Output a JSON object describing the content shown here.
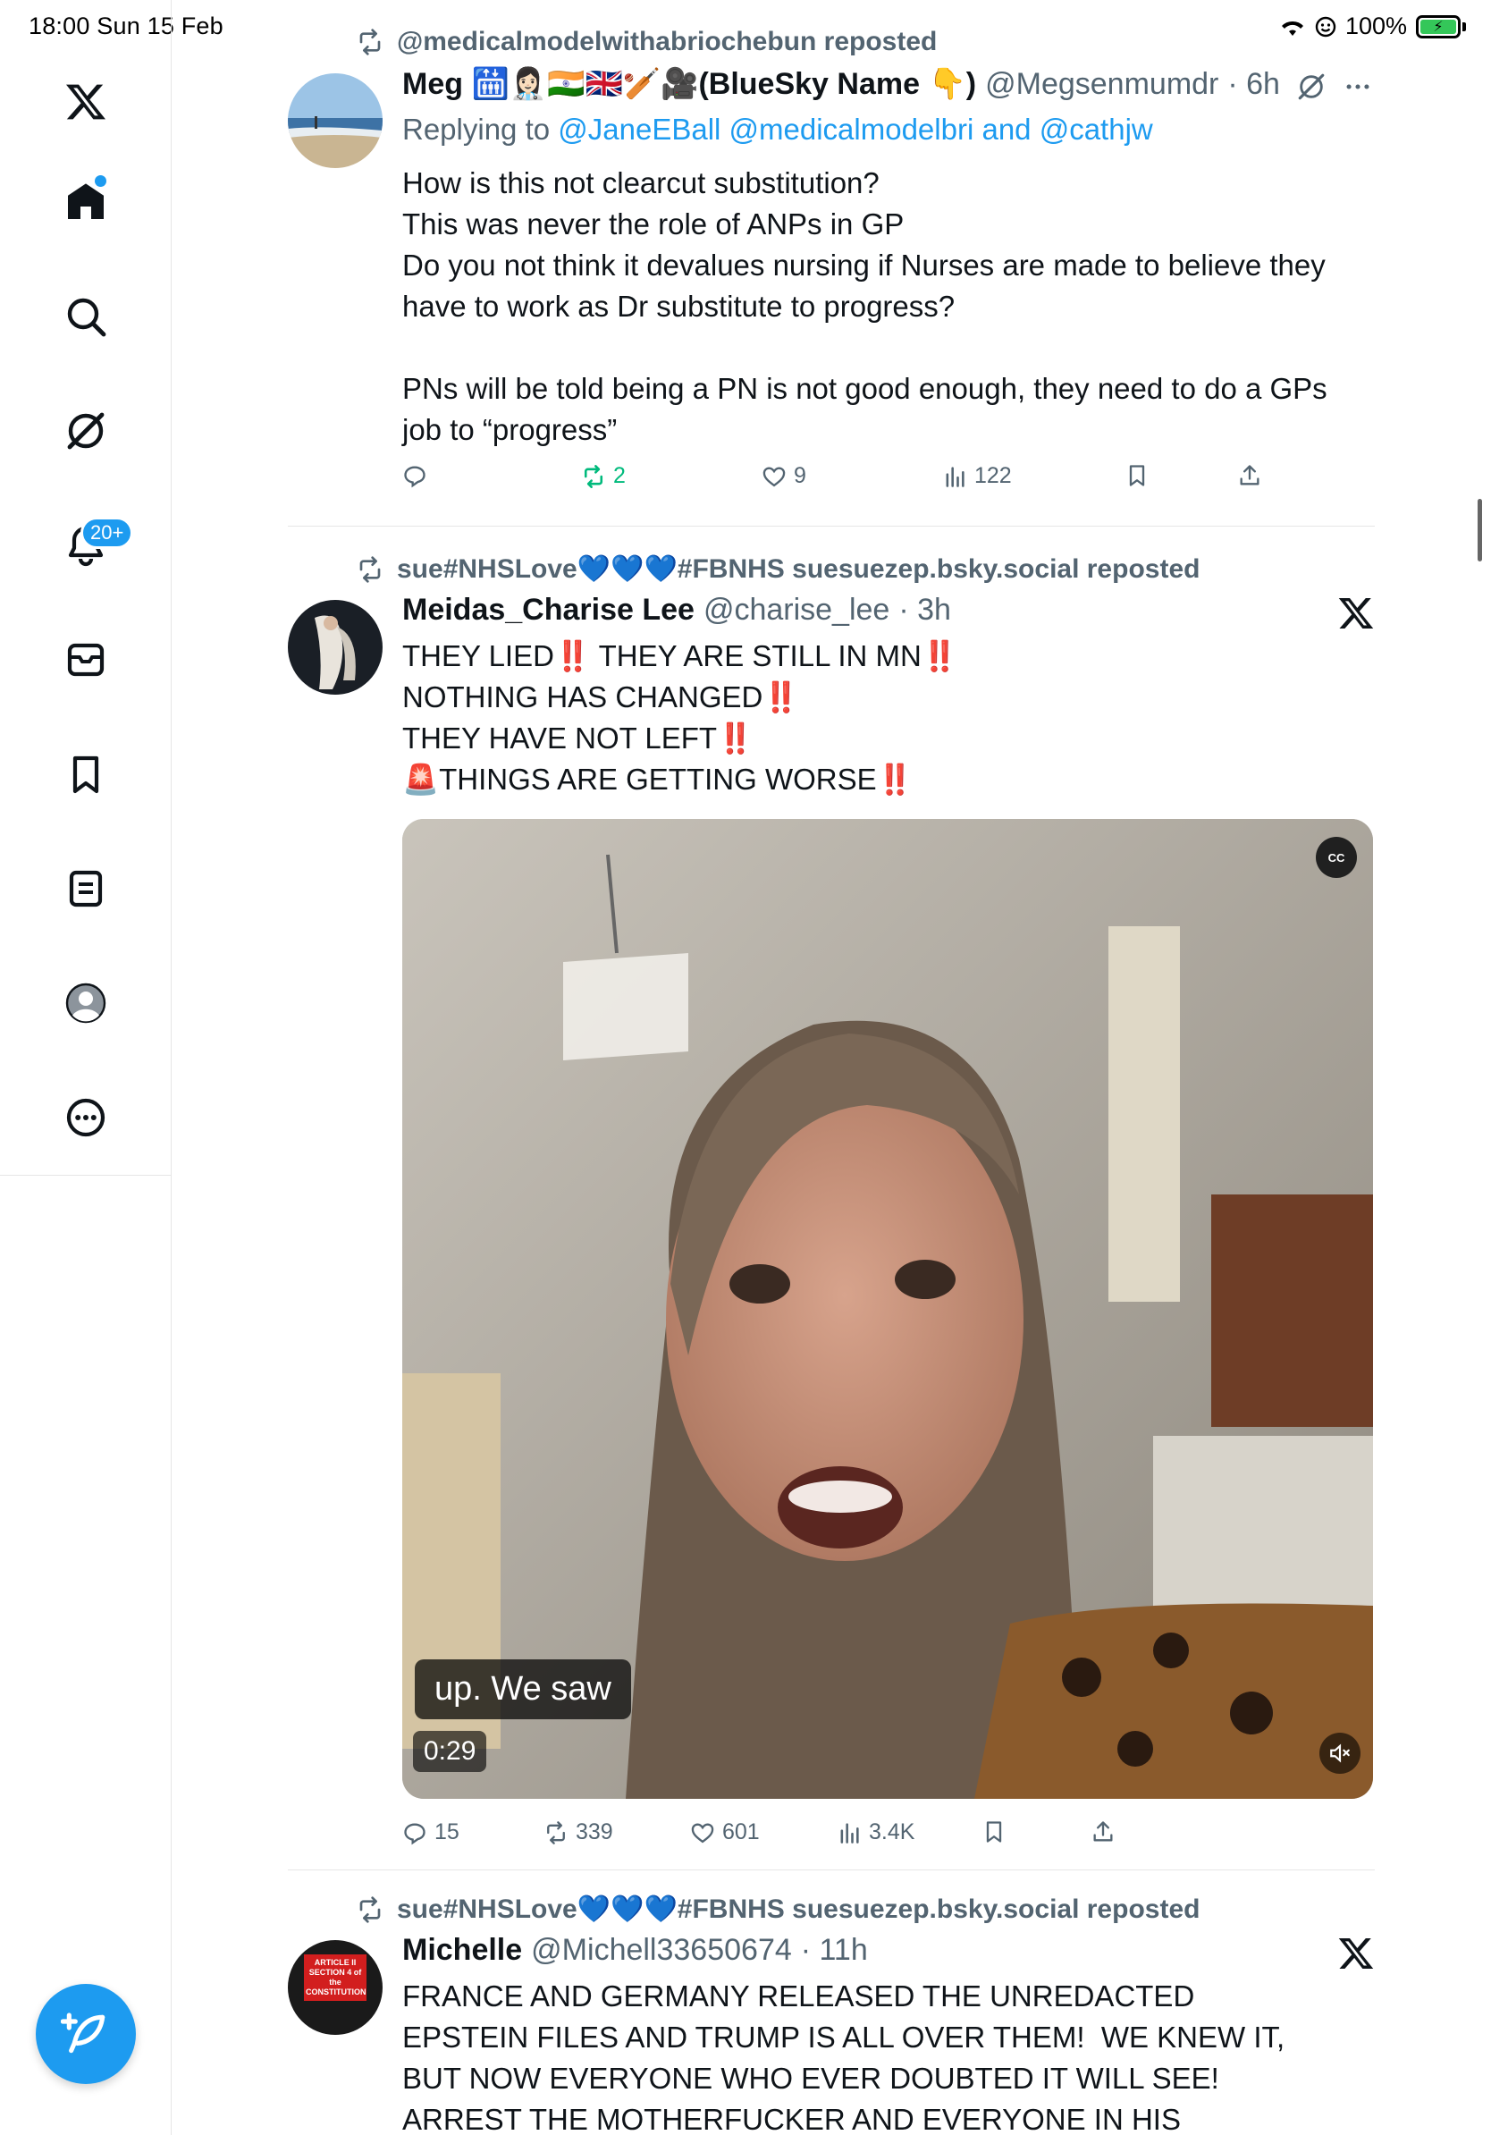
{
  "status_bar": {
    "time_date": "18:00  Sun 15 Feb",
    "battery": "100%"
  },
  "sidebar": {
    "notifications_badge": "20+"
  },
  "tweets": [
    {
      "repost_label": "@medicalmodelwithabriochebun reposted",
      "name": "Meg 🛗👩🏻‍⚕️🇮🇳🇬🇧🏏🎥(BlueSky Name 👇)",
      "handle": "@Megsenmumdr",
      "time": "· 6h",
      "reply_prefix": "Replying to ",
      "reply_targets": "@JaneEBall @medicalmodelbri and @cathjw",
      "body": [
        "How is this not clearcut substitution?",
        "This was never the role of ANPs in GP",
        "Do you not think it devalues nursing if Nurses are made to believe they have to work as Dr substitute to progress?",
        "",
        "PNs will be told being a PN is not good enough, they need to do a GPs job to “progress”"
      ],
      "stats": {
        "replies": "",
        "reposts": "2",
        "likes": "9",
        "views": "122"
      }
    },
    {
      "repost_label": "sue#NHSLove💙💙💙#FBNHS suesuezep.bsky.social reposted",
      "name": "Meidas_Charise Lee",
      "handle": "@charise_lee",
      "time": "· 3h",
      "body": [
        "THEY LIED‼️ THEY ARE STILL IN MN‼️",
        "NOTHING HAS CHANGED‼️",
        "THEY HAVE NOT LEFT‼️",
        "🚨THINGS ARE GETTING WORSE‼️"
      ],
      "video": {
        "caption": "up. We saw",
        "duration": "0:29",
        "cc_label": "CC"
      },
      "stats": {
        "replies": "15",
        "reposts": "339",
        "likes": "601",
        "views": "3.4K"
      }
    },
    {
      "repost_label": "sue#NHSLove💙💙💙#FBNHS suesuezep.bsky.social reposted",
      "name": "Michelle",
      "handle": "@Michell33650674",
      "time": "· 11h",
      "avatar_text": "ARTICLE II SECTION 4 of the CONSTITUTION",
      "body": [
        "FRANCE AND GERMANY RELEASED THE UNREDACTED EPSTEIN FILES AND TRUMP IS ALL OVER THEM!  WE KNEW IT, BUT NOW EVERYONE WHO EVER DOUBTED IT WILL SEE!  ARREST THE MOTHERFUCKER AND EVERYONE IN HIS REGIME!  ARREST"
      ]
    }
  ]
}
